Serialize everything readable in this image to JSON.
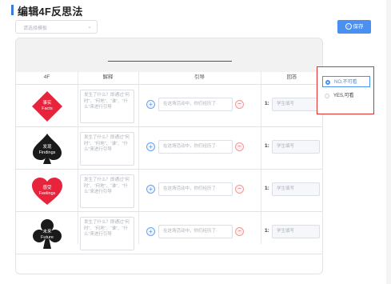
{
  "page": {
    "title": "编辑4F反思法"
  },
  "template_select": {
    "placeholder": "请选择模板"
  },
  "toolbar": {
    "save_label": "保存"
  },
  "table": {
    "headers": [
      "4F",
      "解释",
      "引导",
      "回答"
    ],
    "rows": [
      {
        "suit": "diamond",
        "color": "#e8243c",
        "zh": "事实",
        "en": "Facts",
        "explanation": "发生了什么？即通过“何时”、“何地”、“谁”、“什么”来进行引导",
        "guide_placeholder": "在这场活动中，你们经历了·",
        "num": "1:",
        "answer_placeholder": "学生填写"
      },
      {
        "suit": "spade",
        "color": "#1a1a1a",
        "zh": "发现",
        "en": "Findings",
        "explanation": "发生了什么？即通过“何时”、“何地”、“谁”、“什么”来进行引导",
        "guide_placeholder": "在这场活动中，你们经历了·",
        "num": "1:",
        "answer_placeholder": "学生填写"
      },
      {
        "suit": "heart",
        "color": "#e8243c",
        "zh": "感受",
        "en": "Feelings",
        "explanation": "发生了什么？即通过“何时”、“何地”、“谁”、“什么”来进行引导",
        "guide_placeholder": "在这场活动中，你们经历了·",
        "num": "1:",
        "answer_placeholder": "学生填写"
      },
      {
        "suit": "club",
        "color": "#1a1a1a",
        "zh": "未来",
        "en": "Future",
        "explanation": "发生了什么？即通过“何时”、“何地”、“谁”、“什么”来进行引导",
        "guide_placeholder": "在这场活动中，你们经历了·",
        "num": "1:",
        "answer_placeholder": "学生填写"
      }
    ]
  },
  "visibility_popup": {
    "options": [
      {
        "label": "NO,不可看",
        "selected": true
      },
      {
        "label": "YES,可看",
        "selected": false
      }
    ]
  },
  "colors": {
    "accent": "#4a90f0",
    "danger": "#e03030"
  },
  "icons": {
    "save": "check-circle-icon",
    "select": "chevron-down-icon",
    "add": "plus-icon",
    "remove": "minus-icon"
  }
}
